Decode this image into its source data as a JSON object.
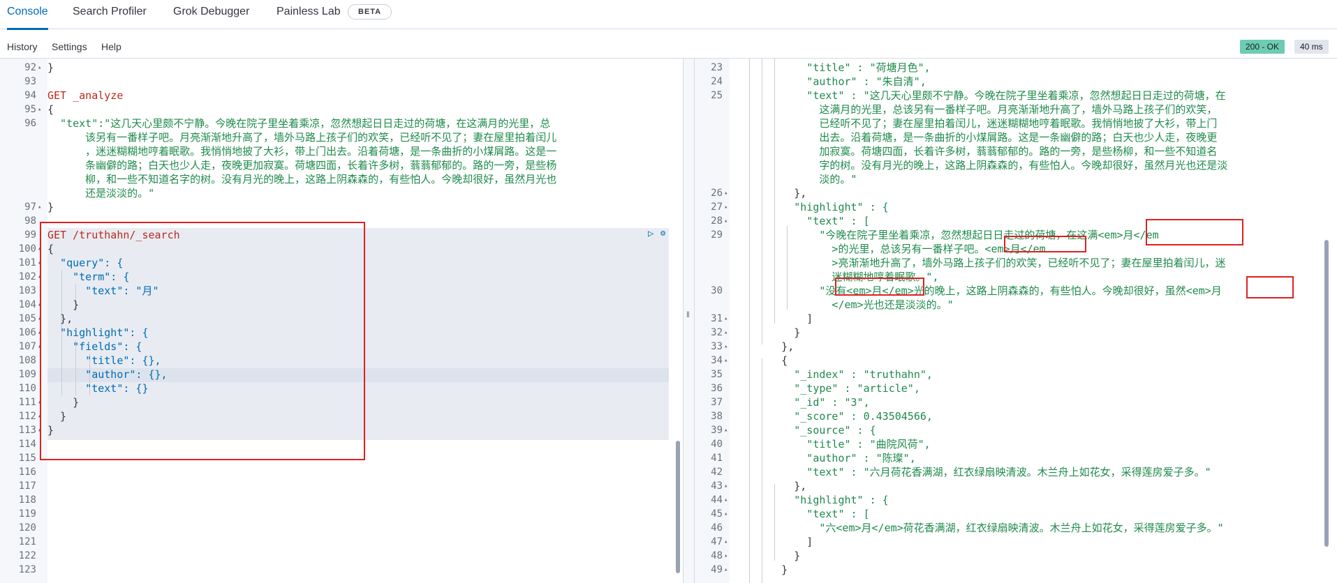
{
  "tabs": [
    {
      "label": "Console",
      "active": true
    },
    {
      "label": "Search Profiler",
      "active": false
    },
    {
      "label": "Grok Debugger",
      "active": false
    },
    {
      "label": "Painless Lab",
      "active": false
    }
  ],
  "beta_badge": "BETA",
  "toolbar": {
    "history": "History",
    "settings": "Settings",
    "help": "Help"
  },
  "status": {
    "code": "200 - OK",
    "time": "40 ms"
  },
  "colors": {
    "accent": "#006bb4",
    "status_ok": "#6dccb1",
    "highlight_box": "#e02020"
  },
  "request_lines": [
    {
      "n": "92",
      "fold": true,
      "text": "}",
      "cls": "p"
    },
    {
      "n": "93",
      "text": "",
      "cls": "p"
    },
    {
      "n": "94",
      "text": "GET _analyze",
      "cls": "m"
    },
    {
      "n": "95",
      "fold": true,
      "text": "{",
      "cls": "p"
    },
    {
      "n": "96",
      "text": "  \"text\":\"这几天心里颇不宁静。今晚在院子里坐着乘凉，忽然想起日日走过的荷塘，在这满月的光里，总",
      "cls": "s"
    },
    {
      "n": "",
      "text": "      该另有一番样子吧。月亮渐渐地升高了，墙外马路上孩子们的欢笑，已经听不见了；妻在屋里拍着闰儿",
      "cls": "s"
    },
    {
      "n": "",
      "text": "      ，迷迷糊糊地哼着眠歌。我悄悄地披了大衫，带上门出去。沿着荷塘，是一条曲折的小煤屑路。这是一",
      "cls": "s"
    },
    {
      "n": "",
      "text": "      条幽僻的路；白天也少人走，夜晚更加寂寞。荷塘四面，长着许多树，蓊蓊郁郁的。路的一旁，是些杨",
      "cls": "s"
    },
    {
      "n": "",
      "text": "      柳，和一些不知道名字的树。没有月光的晚上，这路上阴森森的，有些怕人。今晚却很好，虽然月光也",
      "cls": "s"
    },
    {
      "n": "",
      "text": "      还是淡淡的。\"",
      "cls": "s"
    },
    {
      "n": "97",
      "fold": true,
      "text": "}",
      "cls": "p"
    },
    {
      "n": "98",
      "text": "",
      "cls": "p"
    },
    {
      "n": "99",
      "text": "GET /truthahn/_search",
      "cls": "m"
    },
    {
      "n": "100",
      "fold": true,
      "text": "{",
      "cls": "p"
    },
    {
      "n": "101",
      "fold": true,
      "text": "  \"query\": {",
      "cls": "n"
    },
    {
      "n": "102",
      "fold": true,
      "text": "    \"term\": {",
      "cls": "n"
    },
    {
      "n": "103",
      "text": "      \"text\": \"月\"",
      "cls": "n"
    },
    {
      "n": "104",
      "fold": true,
      "text": "    }",
      "cls": "p"
    },
    {
      "n": "105",
      "fold": true,
      "text": "  },",
      "cls": "p"
    },
    {
      "n": "106",
      "fold": true,
      "text": "  \"highlight\": {",
      "cls": "n"
    },
    {
      "n": "107",
      "fold": true,
      "text": "    \"fields\": {",
      "cls": "n"
    },
    {
      "n": "108",
      "text": "      \"title\": {},",
      "cls": "n"
    },
    {
      "n": "109",
      "text": "      \"author\": {},",
      "cls": "n"
    },
    {
      "n": "110",
      "text": "      \"text\": {}",
      "cls": "n"
    },
    {
      "n": "111",
      "fold": true,
      "text": "    }",
      "cls": "p"
    },
    {
      "n": "112",
      "fold": true,
      "text": "  }",
      "cls": "p"
    },
    {
      "n": "113",
      "fold": true,
      "text": "}",
      "cls": "p"
    },
    {
      "n": "114",
      "text": "",
      "cls": "p"
    },
    {
      "n": "115",
      "text": "",
      "cls": "p"
    },
    {
      "n": "116",
      "text": "",
      "cls": "p"
    },
    {
      "n": "117",
      "text": "",
      "cls": "p"
    },
    {
      "n": "118",
      "text": "",
      "cls": "p"
    },
    {
      "n": "119",
      "text": "",
      "cls": "p"
    },
    {
      "n": "120",
      "text": "",
      "cls": "p"
    },
    {
      "n": "121",
      "text": "",
      "cls": "p"
    },
    {
      "n": "122",
      "text": "",
      "cls": "p"
    },
    {
      "n": "123",
      "text": "",
      "cls": "p"
    }
  ],
  "response_lines": [
    {
      "n": "23",
      "text": "          \"title\" : \"荷塘月色\",",
      "cls": "s"
    },
    {
      "n": "24",
      "text": "          \"author\" : \"朱自清\",",
      "cls": "s"
    },
    {
      "n": "25",
      "text": "          \"text\" : \"这几天心里颇不宁静。今晚在院子里坐着乘凉，忽然想起日日走过的荷塘，在",
      "cls": "s"
    },
    {
      "n": "",
      "text": "            这满月的光里，总该另有一番样子吧。月亮渐渐地升高了，墙外马路上孩子们的欢笑，",
      "cls": "s"
    },
    {
      "n": "",
      "text": "            已经听不见了；妻在屋里拍着闰儿，迷迷糊糊地哼着眠歌。我悄悄地披了大衫，带上门",
      "cls": "s"
    },
    {
      "n": "",
      "text": "            出去。沿着荷塘，是一条曲折的小煤屑路。这是一条幽僻的路；白天也少人走，夜晚更",
      "cls": "s"
    },
    {
      "n": "",
      "text": "            加寂寞。荷塘四面，长着许多树，蓊蓊郁郁的。路的一旁，是些杨柳，和一些不知道名",
      "cls": "s"
    },
    {
      "n": "",
      "text": "            字的树。没有月光的晚上，这路上阴森森的，有些怕人。今晚却很好，虽然月光也还是淡",
      "cls": "s"
    },
    {
      "n": "",
      "text": "            淡的。\"",
      "cls": "s"
    },
    {
      "n": "26",
      "fold": true,
      "text": "        },",
      "cls": "p"
    },
    {
      "n": "27",
      "fold": true,
      "text": "        \"highlight\" : {",
      "cls": "s"
    },
    {
      "n": "28",
      "fold": true,
      "text": "          \"text\" : [",
      "cls": "s"
    },
    {
      "n": "29",
      "text": "            \"今晚在院子里坐着乘凉，忽然想起日日走过的荷塘，在这满<em>月</em",
      "cls": "s"
    },
    {
      "n": "",
      "text": "              >的光里，总该另有一番样子吧。<em>月</em",
      "cls": "s"
    },
    {
      "n": "",
      "text": "              >亮渐渐地升高了，墙外马路上孩子们的欢笑，已经听不见了；妻在屋里拍着闰儿，迷",
      "cls": "s"
    },
    {
      "n": "",
      "text": "              迷糊糊地哼着眠歌。\",",
      "cls": "s"
    },
    {
      "n": "30",
      "text": "            \"没有<em>月</em>光的晚上，这路上阴森森的，有些怕人。今晚却很好，虽然<em>月",
      "cls": "s"
    },
    {
      "n": "",
      "text": "              </em>光也还是淡淡的。\"",
      "cls": "s"
    },
    {
      "n": "31",
      "fold": true,
      "text": "          ]",
      "cls": "p"
    },
    {
      "n": "32",
      "fold": true,
      "text": "        }",
      "cls": "p"
    },
    {
      "n": "33",
      "fold": true,
      "text": "      },",
      "cls": "p"
    },
    {
      "n": "34",
      "fold": true,
      "text": "      {",
      "cls": "p"
    },
    {
      "n": "35",
      "text": "        \"_index\" : \"truthahn\",",
      "cls": "s"
    },
    {
      "n": "36",
      "text": "        \"_type\" : \"article\",",
      "cls": "s"
    },
    {
      "n": "37",
      "text": "        \"_id\" : \"3\",",
      "cls": "s"
    },
    {
      "n": "38",
      "text": "        \"_score\" : 0.43504566,",
      "cls": "s"
    },
    {
      "n": "39",
      "fold": true,
      "text": "        \"_source\" : {",
      "cls": "s"
    },
    {
      "n": "40",
      "text": "          \"title\" : \"曲院风荷\",",
      "cls": "s"
    },
    {
      "n": "41",
      "text": "          \"author\" : \"陈璨\",",
      "cls": "s"
    },
    {
      "n": "42",
      "text": "          \"text\" : \"六月荷花香满湖，红衣绿扇映清波。木兰舟上如花女，采得莲房爱子多。\"",
      "cls": "s"
    },
    {
      "n": "43",
      "fold": true,
      "text": "        },",
      "cls": "p"
    },
    {
      "n": "44",
      "fold": true,
      "text": "        \"highlight\" : {",
      "cls": "s"
    },
    {
      "n": "45",
      "fold": true,
      "text": "          \"text\" : [",
      "cls": "s"
    },
    {
      "n": "46",
      "text": "            \"六<em>月</em>荷花香满湖，红衣绿扇映清波。木兰舟上如花女，采得莲房爱子多。\"",
      "cls": "s"
    },
    {
      "n": "47",
      "fold": true,
      "text": "          ]",
      "cls": "p"
    },
    {
      "n": "48",
      "fold": true,
      "text": "        }",
      "cls": "p"
    },
    {
      "n": "49",
      "fold": true,
      "text": "      }",
      "cls": "p"
    }
  ],
  "icons": {
    "play": "▷",
    "wrench": "🔧",
    "fold": "▴",
    "divider": "‖"
  }
}
